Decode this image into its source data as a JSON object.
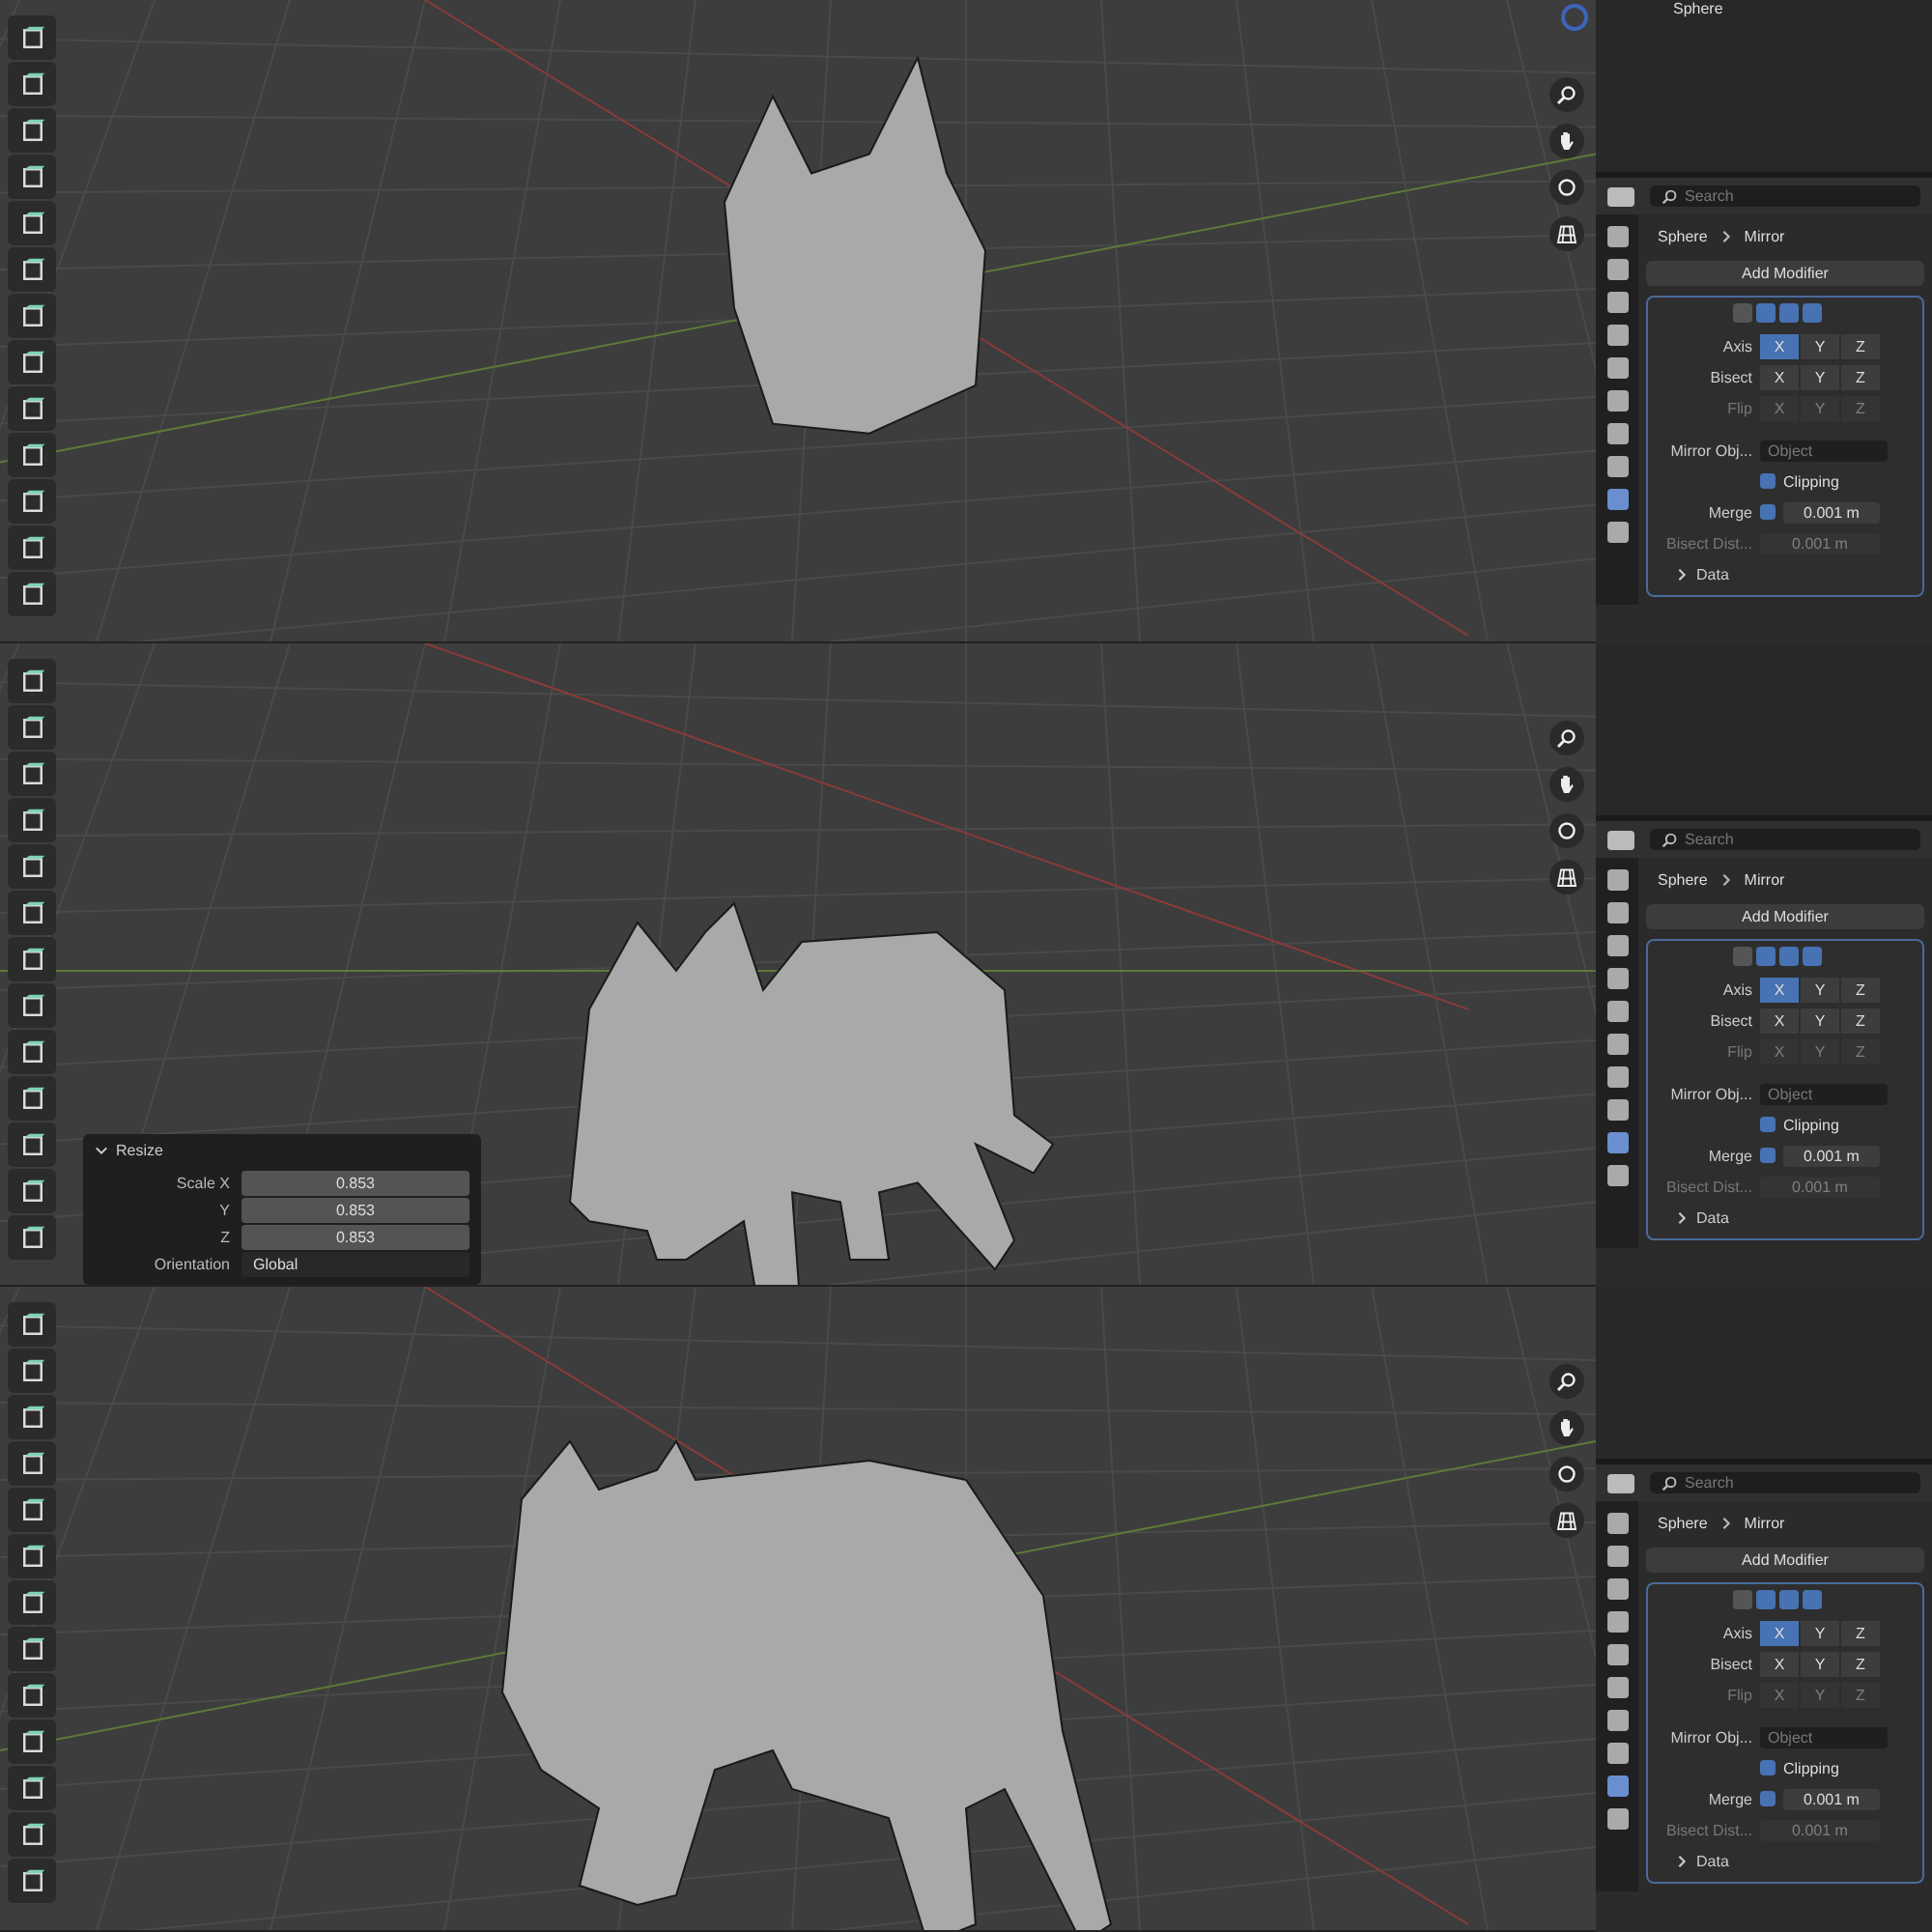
{
  "outliner_row": {
    "label": "Sphere"
  },
  "sections": [
    {
      "properties": {
        "search": {
          "placeholder": "Search"
        },
        "object": "Sphere",
        "modifier": "Mirror",
        "add_button": "Add Modifier",
        "axis_rows": [
          {
            "label": "Axis",
            "disabled": false,
            "buttons": [
              {
                "label": "X",
                "selected": true
              },
              {
                "label": "Y",
                "selected": false
              },
              {
                "label": "Z",
                "selected": false
              }
            ]
          },
          {
            "label": "Bisect",
            "disabled": false,
            "buttons": [
              {
                "label": "X",
                "selected": false
              },
              {
                "label": "Y",
                "selected": false
              },
              {
                "label": "Z",
                "selected": false
              }
            ]
          },
          {
            "label": "Flip",
            "disabled": true,
            "buttons": [
              {
                "label": "X",
                "selected": false
              },
              {
                "label": "Y",
                "selected": false
              },
              {
                "label": "Z",
                "selected": false
              }
            ]
          }
        ],
        "mirror_object": {
          "label": "Mirror Obj...",
          "placeholder": "Object"
        },
        "clipping": {
          "label": "Clipping",
          "checked": true
        },
        "merge": {
          "label": "Merge",
          "checked": true,
          "value": "0.001 m"
        },
        "bisect_distance": {
          "label": "Bisect Dist...",
          "value": "0.001 m",
          "disabled": true
        },
        "data_section": "Data"
      }
    },
    {
      "operator_panel": {
        "title": "Resize",
        "fields": [
          {
            "label": "Scale X",
            "value": "0.853"
          },
          {
            "label": "Y",
            "value": "0.853"
          },
          {
            "label": "Z",
            "value": "0.853"
          }
        ],
        "orientation": {
          "label": "Orientation",
          "value": "Global"
        }
      },
      "properties": {
        "search": {
          "placeholder": "Search"
        },
        "object": "Sphere",
        "modifier": "Mirror",
        "add_button": "Add Modifier",
        "axis_rows": [
          {
            "label": "Axis",
            "disabled": false,
            "buttons": [
              {
                "label": "X",
                "selected": true
              },
              {
                "label": "Y",
                "selected": false
              },
              {
                "label": "Z",
                "selected": false
              }
            ]
          },
          {
            "label": "Bisect",
            "disabled": false,
            "buttons": [
              {
                "label": "X",
                "selected": false
              },
              {
                "label": "Y",
                "selected": false
              },
              {
                "label": "Z",
                "selected": false
              }
            ]
          },
          {
            "label": "Flip",
            "disabled": true,
            "buttons": [
              {
                "label": "X",
                "selected": false
              },
              {
                "label": "Y",
                "selected": false
              },
              {
                "label": "Z",
                "selected": false
              }
            ]
          }
        ],
        "mirror_object": {
          "label": "Mirror Obj...",
          "placeholder": "Object"
        },
        "clipping": {
          "label": "Clipping",
          "checked": true
        },
        "merge": {
          "label": "Merge",
          "checked": true,
          "value": "0.001 m"
        },
        "bisect_distance": {
          "label": "Bisect Dist...",
          "value": "0.001 m",
          "disabled": true
        },
        "data_section": "Data"
      }
    },
    {
      "properties": {
        "search": {
          "placeholder": "Search"
        },
        "object": "Sphere",
        "modifier": "Mirror",
        "add_button": "Add Modifier",
        "axis_rows": [
          {
            "label": "Axis",
            "disabled": false,
            "buttons": [
              {
                "label": "X",
                "selected": true
              },
              {
                "label": "Y",
                "selected": false
              },
              {
                "label": "Z",
                "selected": false
              }
            ]
          },
          {
            "label": "Bisect",
            "disabled": false,
            "buttons": [
              {
                "label": "X",
                "selected": false
              },
              {
                "label": "Y",
                "selected": false
              },
              {
                "label": "Z",
                "selected": false
              }
            ]
          },
          {
            "label": "Flip",
            "disabled": true,
            "buttons": [
              {
                "label": "X",
                "selected": false
              },
              {
                "label": "Y",
                "selected": false
              },
              {
                "label": "Z",
                "selected": false
              }
            ]
          }
        ],
        "mirror_object": {
          "label": "Mirror Obj...",
          "placeholder": "Object"
        },
        "clipping": {
          "label": "Clipping",
          "checked": true
        },
        "merge": {
          "label": "Merge",
          "checked": true,
          "value": "0.001 m"
        },
        "bisect_distance": {
          "label": "Bisect Dist...",
          "value": "0.001 m",
          "disabled": true
        },
        "data_section": "Data"
      }
    }
  ]
}
